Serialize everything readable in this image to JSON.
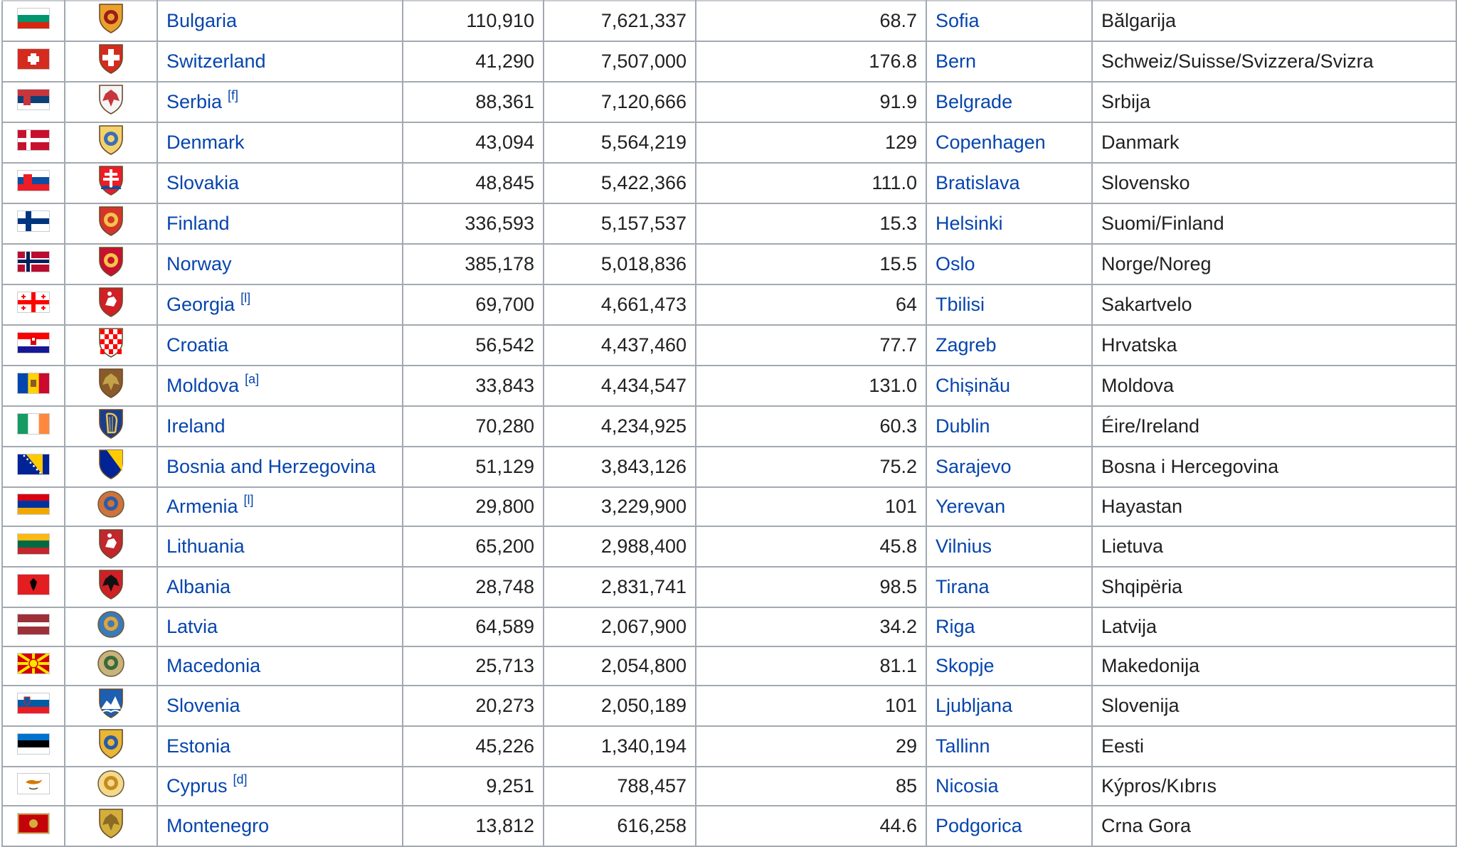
{
  "table": {
    "rows": [
      {
        "country": "Bulgaria",
        "note": "",
        "area": "110,910",
        "population": "7,621,337",
        "density": "68.7",
        "capital": "Sofia",
        "native_name": "Bălgarija",
        "flag": "bulgaria-flag-icon",
        "arms": "bulgaria-coat-of-arms-icon"
      },
      {
        "country": "Switzerland",
        "note": "",
        "area": "41,290",
        "population": "7,507,000",
        "density": "176.8",
        "capital": "Bern",
        "native_name": "Schweiz/Suisse/Svizzera/Svizra",
        "flag": "switzerland-flag-icon",
        "arms": "switzerland-coat-of-arms-icon"
      },
      {
        "country": "Serbia",
        "note": "[f]",
        "area": "88,361",
        "population": "7,120,666",
        "density": "91.9",
        "capital": "Belgrade",
        "native_name": "Srbija",
        "flag": "serbia-flag-icon",
        "arms": "serbia-coat-of-arms-icon"
      },
      {
        "country": "Denmark",
        "note": "",
        "area": "43,094",
        "population": "5,564,219",
        "density": "129",
        "capital": "Copenhagen",
        "native_name": "Danmark",
        "flag": "denmark-flag-icon",
        "arms": "denmark-coat-of-arms-icon"
      },
      {
        "country": "Slovakia",
        "note": "",
        "area": "48,845",
        "population": "5,422,366",
        "density": "111.0",
        "capital": "Bratislava",
        "native_name": "Slovensko",
        "flag": "slovakia-flag-icon",
        "arms": "slovakia-coat-of-arms-icon"
      },
      {
        "country": "Finland",
        "note": "",
        "area": "336,593",
        "population": "5,157,537",
        "density": "15.3",
        "capital": "Helsinki",
        "native_name": "Suomi/Finland",
        "flag": "finland-flag-icon",
        "arms": "finland-coat-of-arms-icon"
      },
      {
        "country": "Norway",
        "note": "",
        "area": "385,178",
        "population": "5,018,836",
        "density": "15.5",
        "capital": "Oslo",
        "native_name": "Norge/Noreg",
        "flag": "norway-flag-icon",
        "arms": "norway-coat-of-arms-icon"
      },
      {
        "country": "Georgia",
        "note": "[l]",
        "area": "69,700",
        "population": "4,661,473",
        "density": "64",
        "capital": "Tbilisi",
        "native_name": "Sakartvelo",
        "flag": "georgia-flag-icon",
        "arms": "georgia-coat-of-arms-icon"
      },
      {
        "country": "Croatia",
        "note": "",
        "area": "56,542",
        "population": "4,437,460",
        "density": "77.7",
        "capital": "Zagreb",
        "native_name": "Hrvatska",
        "flag": "croatia-flag-icon",
        "arms": "croatia-coat-of-arms-icon"
      },
      {
        "country": "Moldova",
        "note": "[a]",
        "area": "33,843",
        "population": "4,434,547",
        "density": "131.0",
        "capital": "Chișinău",
        "native_name": "Moldova",
        "flag": "moldova-flag-icon",
        "arms": "moldova-coat-of-arms-icon"
      },
      {
        "country": "Ireland",
        "note": "",
        "area": "70,280",
        "population": "4,234,925",
        "density": "60.3",
        "capital": "Dublin",
        "native_name": "Éire/Ireland",
        "flag": "ireland-flag-icon",
        "arms": "ireland-coat-of-arms-icon"
      },
      {
        "country": "Bosnia and Herzegovina",
        "note": "",
        "area": "51,129",
        "population": "3,843,126",
        "density": "75.2",
        "capital": "Sarajevo",
        "native_name": "Bosna i Hercegovina",
        "flag": "bosnia-flag-icon",
        "arms": "bosnia-coat-of-arms-icon"
      },
      {
        "country": "Armenia",
        "note": "[l]",
        "area": "29,800",
        "population": "3,229,900",
        "density": "101",
        "capital": "Yerevan",
        "native_name": "Hayastan",
        "flag": "armenia-flag-icon",
        "arms": "armenia-coat-of-arms-icon"
      },
      {
        "country": "Lithuania",
        "note": "",
        "area": "65,200",
        "population": "2,988,400",
        "density": "45.8",
        "capital": "Vilnius",
        "native_name": "Lietuva",
        "flag": "lithuania-flag-icon",
        "arms": "lithuania-coat-of-arms-icon"
      },
      {
        "country": "Albania",
        "note": "",
        "area": "28,748",
        "population": "2,831,741",
        "density": "98.5",
        "capital": "Tirana",
        "native_name": "Shqipëria",
        "flag": "albania-flag-icon",
        "arms": "albania-coat-of-arms-icon"
      },
      {
        "country": "Latvia",
        "note": "",
        "area": "64,589",
        "population": "2,067,900",
        "density": "34.2",
        "capital": "Riga",
        "native_name": "Latvija",
        "flag": "latvia-flag-icon",
        "arms": "latvia-coat-of-arms-icon"
      },
      {
        "country": "Macedonia",
        "note": "",
        "area": "25,713",
        "population": "2,054,800",
        "density": "81.1",
        "capital": "Skopje",
        "native_name": "Makedonija",
        "flag": "macedonia-flag-icon",
        "arms": "macedonia-coat-of-arms-icon"
      },
      {
        "country": "Slovenia",
        "note": "",
        "area": "20,273",
        "population": "2,050,189",
        "density": "101",
        "capital": "Ljubljana",
        "native_name": "Slovenija",
        "flag": "slovenia-flag-icon",
        "arms": "slovenia-coat-of-arms-icon"
      },
      {
        "country": "Estonia",
        "note": "",
        "area": "45,226",
        "population": "1,340,194",
        "density": "29",
        "capital": "Tallinn",
        "native_name": "Eesti",
        "flag": "estonia-flag-icon",
        "arms": "estonia-coat-of-arms-icon"
      },
      {
        "country": "Cyprus",
        "note": "[d]",
        "area": "9,251",
        "population": "788,457",
        "density": "85",
        "capital": "Nicosia",
        "native_name": "Kýpros/Kıbrıs",
        "flag": "cyprus-flag-icon",
        "arms": "cyprus-coat-of-arms-icon"
      },
      {
        "country": "Montenegro",
        "note": "",
        "area": "13,812",
        "population": "616,258",
        "density": "44.6",
        "capital": "Podgorica",
        "native_name": "Crna Gora",
        "flag": "montenegro-flag-icon",
        "arms": "montenegro-coat-of-arms-icon"
      }
    ]
  }
}
